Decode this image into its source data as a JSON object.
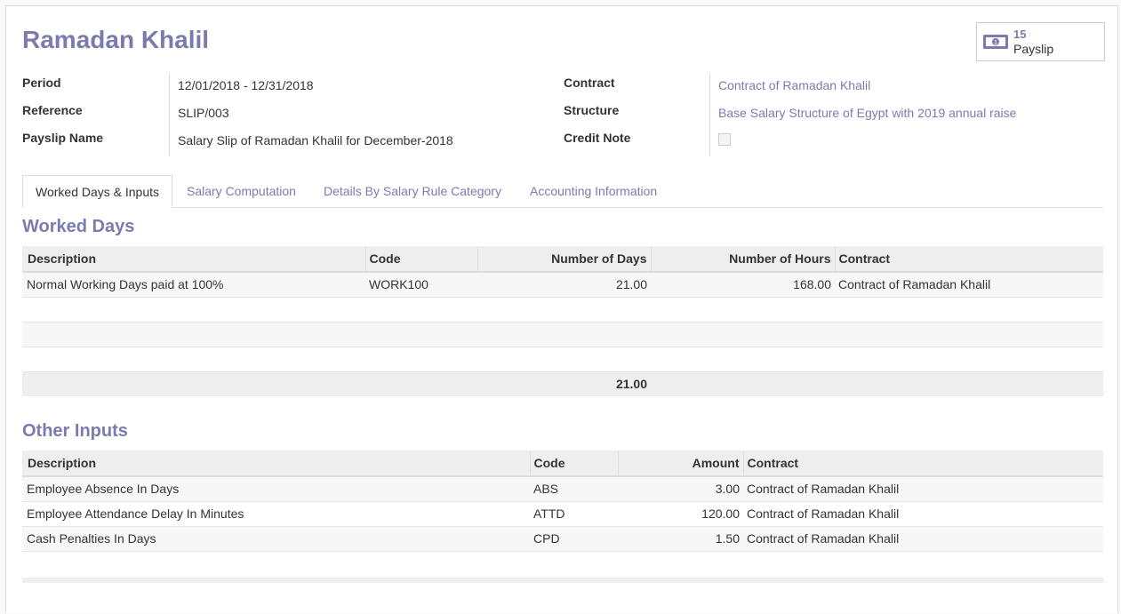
{
  "header": {
    "title": "Ramadan Khalil"
  },
  "smart_button": {
    "count": "15",
    "label": "Payslip",
    "icon": "money-icon"
  },
  "left_fields": [
    {
      "label": "Period",
      "value": "12/01/2018 - 12/31/2018"
    },
    {
      "label": "Reference",
      "value": "SLIP/003"
    },
    {
      "label": "Payslip Name",
      "value": "Salary Slip of Ramadan Khalil for December-2018"
    }
  ],
  "right_fields": [
    {
      "label": "Contract",
      "value": "Contract of Ramadan Khalil"
    },
    {
      "label": "Structure",
      "value": "Base Salary Structure of Egypt with 2019 annual raise"
    },
    {
      "label": "Credit Note",
      "value": ""
    }
  ],
  "tabs": [
    {
      "label": "Worked Days & Inputs"
    },
    {
      "label": "Salary Computation"
    },
    {
      "label": "Details By Salary Rule Category"
    },
    {
      "label": "Accounting Information"
    }
  ],
  "worked_days": {
    "title": "Worked Days",
    "columns": [
      "Description",
      "Code",
      "Number of Days",
      "Number of Hours",
      "Contract"
    ],
    "rows": [
      {
        "description": "Normal Working Days paid at 100%",
        "code": "WORK100",
        "days": "21.00",
        "hours": "168.00",
        "contract": "Contract of Ramadan Khalil"
      }
    ],
    "total_days": "21.00"
  },
  "other_inputs": {
    "title": "Other Inputs",
    "columns": [
      "Description",
      "Code",
      "Amount",
      "Contract"
    ],
    "rows": [
      {
        "description": "Employee Absence In Days",
        "code": "ABS",
        "amount": "3.00",
        "contract": "Contract of Ramadan Khalil"
      },
      {
        "description": "Employee Attendance Delay In Minutes",
        "code": "ATTD",
        "amount": "120.00",
        "contract": "Contract of Ramadan Khalil"
      },
      {
        "description": "Cash Penalties In Days",
        "code": "CPD",
        "amount": "1.50",
        "contract": "Contract of Ramadan Khalil"
      }
    ]
  },
  "colors": {
    "accent": "#7c7bad"
  }
}
